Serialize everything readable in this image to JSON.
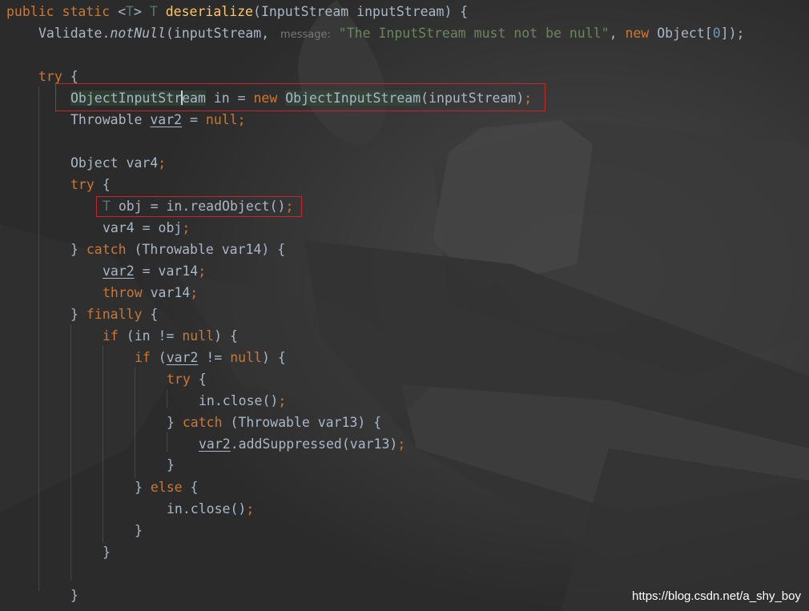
{
  "code": {
    "line1": {
      "public": "public",
      "static": "static",
      "open_angle": "<",
      "generic_T": "T",
      "close_angle": ">",
      "return_type": "T",
      "method_name": "deserialize",
      "paren": "(",
      "param_type": "InputStream",
      "param_name": "inputStream",
      "close": ") {"
    },
    "line2": {
      "class": "Validate",
      "dot": ".",
      "method": "notNull",
      "open": "(inputStream,",
      "hint": "message:",
      "string": "\"The InputStream must not be null\"",
      "comma": ",",
      "new_kw": "new",
      "type": "Object",
      "open_br": "[",
      "number": "0",
      "close": "]);"
    },
    "line3": {
      "kw": "try",
      "brace": " {"
    },
    "line4": {
      "type_a": "ObjectInputStr",
      "type_b": "eam",
      "rest": " in = ",
      "new_kw": "new",
      "ctor": "ObjectInputStream",
      "args": "(inputStream)",
      "semi": ";"
    },
    "line5": {
      "type": "Throwable ",
      "var": "var2",
      "mid": " = ",
      "null_kw": "null",
      "semi": ";"
    },
    "line6": {
      "text": "Object var4",
      "semi": ";"
    },
    "line7": {
      "kw": "try",
      "brace": " {"
    },
    "line8": {
      "type": "T",
      "text": " obj = in.readObject()",
      "semi": ";"
    },
    "line9": {
      "text": "var4 = obj",
      "semi": ";"
    },
    "line10": {
      "brace": "} ",
      "kw": "catch",
      "rest": " (Throwable var14) {"
    },
    "line11": {
      "var": "var2",
      "rest": " = var14",
      "semi": ";"
    },
    "line12": {
      "kw": "throw",
      "rest": " var14",
      "semi": ";"
    },
    "line13": {
      "brace": "} ",
      "kw": "finally",
      "rest": " {"
    },
    "line14": {
      "kw": "if",
      "mid": " (in != ",
      "null_kw": "null",
      "rest": ") {"
    },
    "line15": {
      "kw": "if",
      "open": " (",
      "var": "var2",
      "mid": " != ",
      "null_kw": "null",
      "rest": ") {"
    },
    "line16": {
      "kw": "try",
      "brace": " {"
    },
    "line17": {
      "text": "in.close()",
      "semi": ";"
    },
    "line18": {
      "brace": "} ",
      "kw": "catch",
      "rest": " (Throwable var13) {"
    },
    "line19": {
      "var": "var2",
      "rest": ".addSuppressed(var13)",
      "semi": ";"
    },
    "line20": {
      "brace": "}"
    },
    "line21": {
      "brace": "} ",
      "kw": "else",
      "rest": " {"
    },
    "line22": {
      "text": "in.close()",
      "semi": ";"
    },
    "line23": {
      "brace": "}"
    },
    "line24": {
      "brace": "}"
    },
    "line26": {
      "brace": "}"
    }
  },
  "watermark": "https://blog.csdn.net/a_shy_boy",
  "colors": {
    "background": "#2b2b2b",
    "keyword": "#cc7832",
    "method": "#ffc66d",
    "string": "#6a8759",
    "number": "#6897bb",
    "text": "#a9b7c6",
    "type_param": "#507874",
    "highlight_box": "#c8252c"
  }
}
